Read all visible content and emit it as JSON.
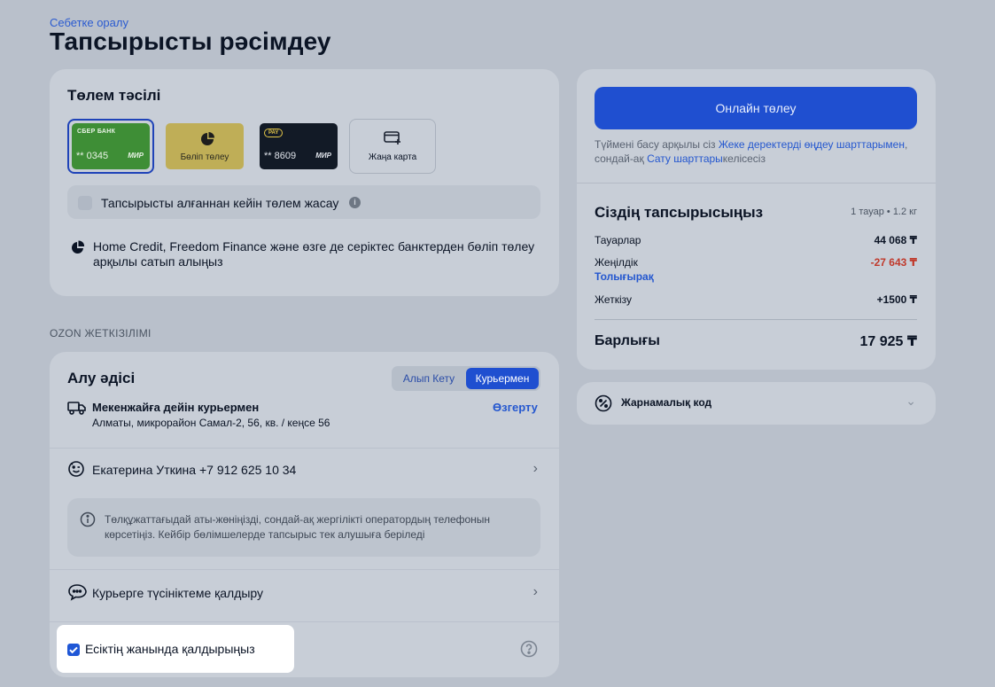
{
  "breadcrumb": "Себетке оралу",
  "page_title": "Тапсырысты рәсімдеу",
  "payment": {
    "heading": "Төлем тәсілі",
    "tiles": {
      "sber_brand": "СБЕР БАНК",
      "sber_number": "** 0345",
      "mir": "МИР",
      "split_label": "Бөліп төлеу",
      "pay_badge": "PAY",
      "pay_number": "** 8609",
      "new_card_label": "Жаңа карта"
    },
    "after_receive_label": "Тапсырысты алғаннан кейін төлем жасау",
    "partner_text": "Home Credit, Freedom Finance және өзге де серіктес банктерден бөліп төлеу арқылы сатып алыңыз"
  },
  "delivery": {
    "section_label": "OZON ЖЕТКІЗІЛІМІ",
    "heading": "Алу әдісі",
    "segment": {
      "pickup": "Алып Кету",
      "courier": "Курьермен"
    },
    "address_title": "Мекенжайға дейін курьермен",
    "address_change": "Өзгерту",
    "address_line": "Алматы, микрорайон Самал-2, 56, кв. / кеңсе 56",
    "recipient": "Екатерина Уткина +7 912 625 10 34",
    "note": "Төлқұжаттағыдай аты-жөніңізді, сондай-ақ жергілікті оператордың телефонын көрсетіңіз. Кейбір бөлімшелерде тапсырыс тек алушыға беріледі",
    "courier_comment": "Курьерге түсініктеме қалдыру",
    "leave_at_door": "Есіктің жанында қалдырыңыз"
  },
  "summary": {
    "online_button": "Онлайн төлеу",
    "terms_prefix": "Түймені басу арқылы сіз ",
    "terms_link1": "Жеке деректерді өңдеу шарттарымен",
    "terms_middle": ", сондай-ақ ",
    "terms_link2": "Сату шарттары",
    "terms_suffix": "келісесіз",
    "order_title": "Сіздің тапсырысыңыз",
    "order_meta": "1 тауар • 1.2 кг",
    "goods_label": "Тауарлар",
    "goods_value": "44 068 ₸",
    "discount_label": "Жеңілдік",
    "discount_value": "-27 643 ₸",
    "more_link": "Толығырақ",
    "delivery_label": "Жеткізу",
    "delivery_value": "+1500 ₸",
    "total_label": "Барлығы",
    "total_value": "17 925 ₸"
  },
  "promo": {
    "label": "Жарнамалық код"
  }
}
